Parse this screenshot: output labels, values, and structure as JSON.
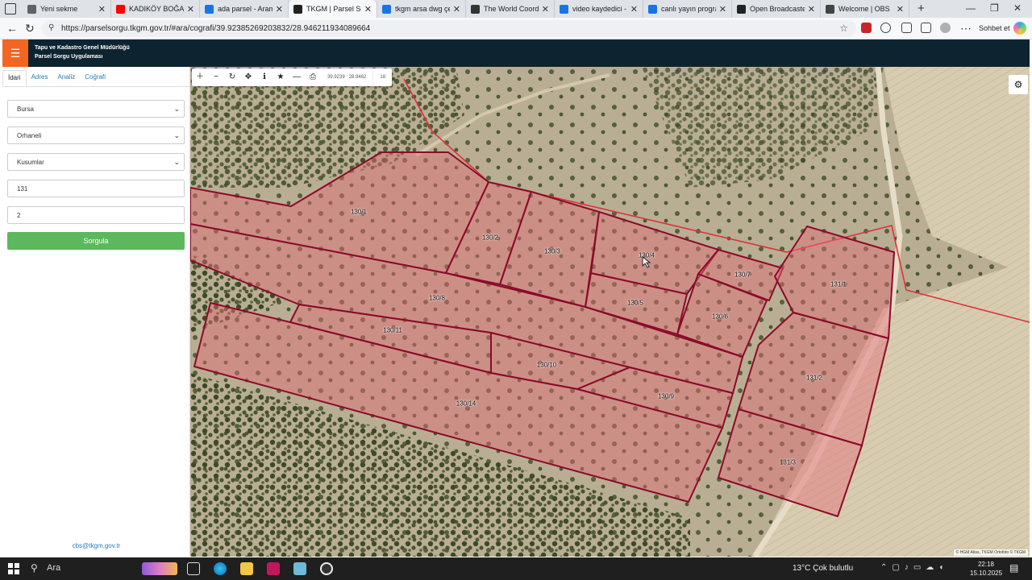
{
  "browser": {
    "tabs": [
      {
        "title": "Yeni sekme",
        "icon": "window-icon",
        "color": "#5f6368"
      },
      {
        "title": "KADIKÖY BOĞASI -",
        "icon": "youtube-icon",
        "color": "#ff0000"
      },
      {
        "title": "ada parsel - Arama",
        "icon": "search-icon",
        "color": "#1a73e8"
      },
      {
        "title": "TKGM | Parsel Sorgu",
        "icon": "location-pin-icon",
        "color": "#222222"
      },
      {
        "title": "tkgm arsa dwg çev",
        "icon": "search-icon",
        "color": "#1a73e8"
      },
      {
        "title": "The World Coordin",
        "icon": "site-icon",
        "color": "#333333"
      },
      {
        "title": "video kaydedici - A",
        "icon": "search-icon",
        "color": "#1a73e8"
      },
      {
        "title": "canlı yayın program",
        "icon": "search-icon",
        "color": "#1a73e8"
      },
      {
        "title": "Open Broadcaster S",
        "icon": "obs-icon",
        "color": "#222222"
      },
      {
        "title": "Welcome | OBS",
        "icon": "globe-icon",
        "color": "#444444"
      }
    ],
    "active_tab": 3,
    "url": "https://parselsorgu.tkgm.gov.tr/#ara/cografi/39.92385269203832/28.946211934089664",
    "chat_label": "Sohbet et"
  },
  "header": {
    "org": "Tapu ve Kadastro Genel Müdürlüğü",
    "app": "Parsel Sorgu Uygulaması",
    "accent": "#f26522",
    "bg": "#0d2430"
  },
  "sidebar": {
    "tabs": [
      "İdari",
      "Adres",
      "Analiz",
      "Coğrafi"
    ],
    "active_tab": 0,
    "province": "Bursa",
    "district": "Orhaneli",
    "neighborhood": "Kusumlar",
    "block": "131",
    "parcel": "2",
    "query_button": "Sorgula",
    "contact": "cbs@tkgm.gov.tr"
  },
  "map": {
    "coordinates": "39.9239 : 28.9462",
    "zoom": "18",
    "attribution": "© HGM Atlas, TKGM Ortofoto © TKGM",
    "parcel_labels": [
      "130/1",
      "130/2",
      "130/3",
      "130/4",
      "130/5",
      "130/6",
      "130/7",
      "131/1",
      "130/8",
      "130/11",
      "130/10",
      "130/9",
      "131/2",
      "130/14",
      "131/3"
    ],
    "parcel_color": "#8b0a2a"
  },
  "taskbar": {
    "search": "Ara",
    "weather": "13°C  Çok bulutlu",
    "time": "22:18",
    "date": "15.10.2025"
  }
}
